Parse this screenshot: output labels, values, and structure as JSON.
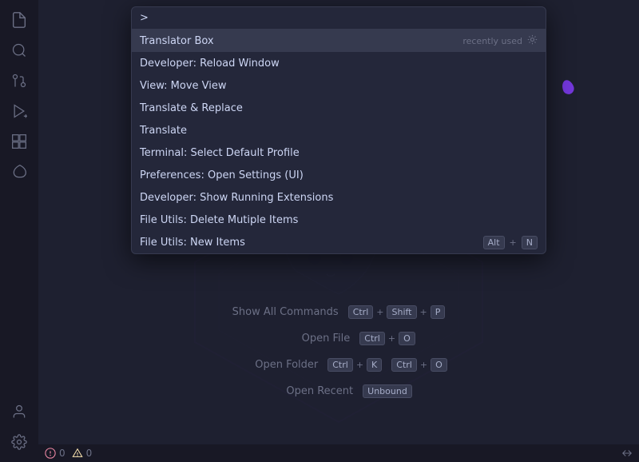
{
  "sidebar": {
    "icons": [
      {
        "name": "files-icon",
        "glyph": "⬜",
        "unicode": "🗂"
      },
      {
        "name": "search-icon",
        "glyph": "🔍"
      },
      {
        "name": "source-control-icon",
        "glyph": "⎇"
      },
      {
        "name": "run-debug-icon",
        "glyph": "▷"
      },
      {
        "name": "extensions-icon",
        "glyph": "⊞"
      },
      {
        "name": "leaf-icon",
        "glyph": "🌿"
      }
    ],
    "bottom_icons": [
      {
        "name": "account-icon",
        "glyph": "👤"
      },
      {
        "name": "settings-icon",
        "glyph": "⚙"
      }
    ]
  },
  "command_palette": {
    "input_value": ">",
    "input_placeholder": "",
    "items": [
      {
        "label": "Translator Box",
        "right_type": "recently_used",
        "shortcut": null,
        "active": true
      },
      {
        "label": "Developer: Reload Window",
        "right_type": null,
        "shortcut": null,
        "active": false
      },
      {
        "label": "View: Move View",
        "right_type": null,
        "shortcut": null,
        "active": false
      },
      {
        "label": "Translate & Replace",
        "right_type": null,
        "shortcut": null,
        "active": false
      },
      {
        "label": "Translate",
        "right_type": null,
        "shortcut": null,
        "active": false
      },
      {
        "label": "Terminal: Select Default Profile",
        "right_type": null,
        "shortcut": null,
        "active": false
      },
      {
        "label": "Preferences: Open Settings (UI)",
        "right_type": null,
        "shortcut": null,
        "active": false
      },
      {
        "label": "Developer: Show Running Extensions",
        "right_type": null,
        "shortcut": null,
        "active": false
      },
      {
        "label": "File Utils: Delete Mutiple Items",
        "right_type": null,
        "shortcut": null,
        "active": false
      },
      {
        "label": "File Utils: New Items",
        "right_type": "shortcut",
        "shortcut": {
          "keys": [
            "Alt",
            "+",
            "N"
          ]
        },
        "active": false
      }
    ]
  },
  "shortcuts": [
    {
      "label": "Show All Commands",
      "keys": [
        {
          "key": "Ctrl",
          "type": "kbd"
        },
        {
          "sep": "+"
        },
        {
          "key": "Shift",
          "type": "kbd"
        },
        {
          "sep": "+"
        },
        {
          "key": "P",
          "type": "kbd"
        }
      ]
    },
    {
      "label": "Open File",
      "keys": [
        {
          "key": "Ctrl",
          "type": "kbd"
        },
        {
          "sep": "+"
        },
        {
          "key": "O",
          "type": "kbd"
        }
      ]
    },
    {
      "label": "Open Folder",
      "keys": [
        {
          "key": "Ctrl",
          "type": "kbd"
        },
        {
          "sep": "+"
        },
        {
          "key": "K",
          "type": "kbd"
        },
        {
          "sep": ""
        },
        {
          "key": "Ctrl",
          "type": "kbd"
        },
        {
          "sep": "+"
        },
        {
          "key": "O",
          "type": "kbd"
        }
      ]
    },
    {
      "label": "Open Recent",
      "keys": [
        {
          "key": "Unbound",
          "type": "kbd"
        }
      ]
    }
  ],
  "status_bar": {
    "errors": "0",
    "warnings": "0",
    "remote_icon": "⇄"
  }
}
